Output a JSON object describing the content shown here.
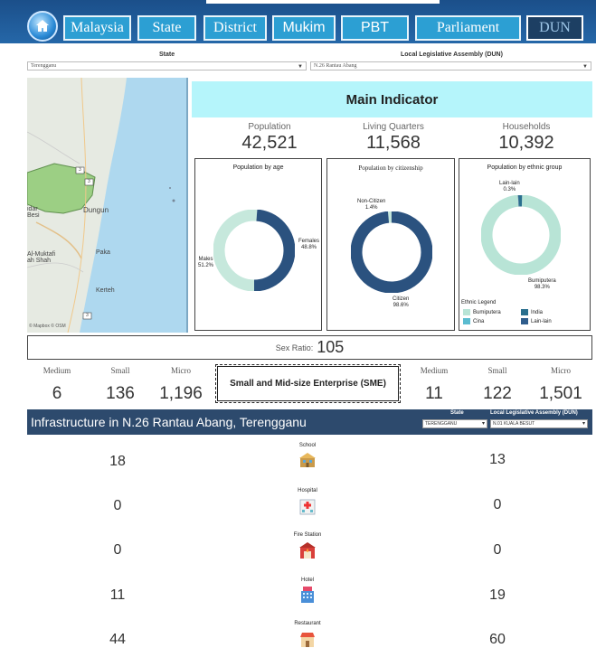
{
  "nav": {
    "home_icon": "home-icon",
    "tabs": [
      {
        "label": "Malaysia"
      },
      {
        "label": "State"
      },
      {
        "label": "District"
      },
      {
        "label": "Mukim"
      },
      {
        "label": "PBT"
      },
      {
        "label": "Parliament"
      },
      {
        "label": "DUN"
      }
    ],
    "active_tab": "DUN"
  },
  "filters": {
    "state_label": "State",
    "state_value": "Terengganu",
    "dun_label": "Local Legislative Assembly (DUN)",
    "dun_value": "N.26 Rantau Abang"
  },
  "map": {
    "labels": [
      "Dungun",
      "Paka",
      "Kerteh",
      "Al-Muktafi\nah Shah",
      "idar\nBesi"
    ],
    "road_badges": [
      "3",
      "3",
      "3"
    ],
    "credit": "© Mapbox © OSM"
  },
  "main": {
    "title": "Main Indicator",
    "kpis": [
      {
        "label": "Population",
        "value": "42,521"
      },
      {
        "label": "Living Quarters",
        "value": "11,568"
      },
      {
        "label": "Households",
        "value": "10,392"
      }
    ]
  },
  "charts": {
    "age": {
      "title": "Population by age",
      "labels": {
        "males": "Males",
        "males_pct": "51.2%",
        "females": "Females",
        "females_pct": "48.8%"
      }
    },
    "citizenship": {
      "title": "Population by citizenship",
      "labels": {
        "noncitizen": "Non-Citizen",
        "noncitizen_pct": "1.4%",
        "citizen": "Citizen",
        "citizen_pct": "98.6%"
      }
    },
    "ethnic": {
      "title": "Population by ethnic group",
      "labels": {
        "lainlain": "Lain-lain",
        "lainlain_pct": "0.3%",
        "bumi": "Bumiputera",
        "bumi_pct": "98.3%"
      },
      "legend_title": "Ethnic Legend",
      "legend": [
        {
          "label": "Bumiputera",
          "color": "#b8e4d6"
        },
        {
          "label": "India",
          "color": "#2a6f8e"
        },
        {
          "label": "Cina",
          "color": "#5bbcd0"
        },
        {
          "label": "Lain-lain",
          "color": "#2f5d8c"
        }
      ]
    }
  },
  "chart_data": [
    {
      "type": "pie",
      "title": "Population by age",
      "categories": [
        "Males",
        "Females"
      ],
      "values": [
        51.2,
        48.8
      ],
      "colors": [
        "#c6e8dc",
        "#2b527f"
      ]
    },
    {
      "type": "pie",
      "title": "Population by citizenship",
      "categories": [
        "Non-Citizen",
        "Citizen"
      ],
      "values": [
        1.4,
        98.6
      ],
      "colors": [
        "#c6e8dc",
        "#2b527f"
      ]
    },
    {
      "type": "pie",
      "title": "Population by ethnic group",
      "categories": [
        "Bumiputera",
        "Lain-lain",
        "India"
      ],
      "values": [
        98.3,
        0.3,
        1.4
      ],
      "colors": [
        "#b8e4d6",
        "#2f5d8c",
        "#2a6f8e"
      ]
    }
  ],
  "sex_ratio": {
    "label": "Sex Ratio:",
    "value": "105"
  },
  "sme": {
    "title": "Small and Mid-size Enterprise (SME)",
    "left": [
      {
        "label": "Medium",
        "value": "6"
      },
      {
        "label": "Small",
        "value": "136"
      },
      {
        "label": "Micro",
        "value": "1,196"
      }
    ],
    "right": [
      {
        "label": "Medium",
        "value": "11"
      },
      {
        "label": "Small",
        "value": "122"
      },
      {
        "label": "Micro",
        "value": "1,501"
      }
    ]
  },
  "infra": {
    "title": "Infrastructure in N.26  Rantau Abang, Terengganu",
    "state_label": "State",
    "state_value": "TERENGGANU",
    "dun_label": "Local Legislative Assembly (DUN)",
    "dun_value": "N.01 KUALA BESUT",
    "rows": [
      {
        "name": "School",
        "left": "18",
        "right": "13",
        "icon": "school-icon"
      },
      {
        "name": "Hospital",
        "left": "0",
        "right": "0",
        "icon": "hospital-icon"
      },
      {
        "name": "Fire Station",
        "left": "0",
        "right": "0",
        "icon": "fire-station-icon"
      },
      {
        "name": "Hotel",
        "left": "11",
        "right": "19",
        "icon": "hotel-icon"
      },
      {
        "name": "Restaurant",
        "left": "44",
        "right": "60",
        "icon": "restaurant-icon"
      }
    ]
  }
}
